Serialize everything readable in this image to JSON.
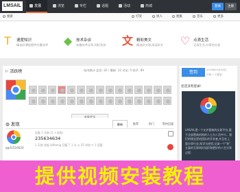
{
  "topnav": {
    "logo": "LMSAIL",
    "items": [
      {
        "label": "发展"
      },
      {
        "label": "浏览"
      },
      {
        "label": "专栏"
      },
      {
        "label": "话题"
      },
      {
        "label": "活动"
      },
      {
        "label": "商城"
      }
    ],
    "login_label": "登录",
    "register_label": "注册"
  },
  "subnav": {
    "search_label": "搜索",
    "items": [
      {
        "label": "打赏"
      },
      {
        "label": "找人"
      },
      {
        "label": "图集"
      },
      {
        "label": "音乐"
      },
      {
        "label": "更多"
      }
    ]
  },
  "cards": [
    {
      "title": "速度知识",
      "desc": "精选好课程提供大量技术",
      "icon": "T",
      "color": "#f0b429"
    },
    {
      "title": "技术杂谈",
      "desc": "有趣技术分享,同好交流",
      "icon": "◆",
      "color": "#6cc24a"
    },
    {
      "title": "精彩美文",
      "desc": "精选好文章,阅读好文",
      "icon": "文",
      "color": "#e8563c"
    },
    {
      "title": "点滴生活",
      "desc": "记录生活,分享的点滴",
      "icon": "♡",
      "color": "#e64f8c"
    }
  ],
  "activity": {
    "title": "活跃榜",
    "stats": "站内统计   会员: 83 / 最新: 22   讨论: 5   帖子: 89",
    "more": "查看更多"
  },
  "discover": {
    "title": "发现",
    "tabs": [
      {
        "label": "最新"
      },
      {
        "label": "推荐"
      },
      {
        "label": "热门"
      },
      {
        "label": "等待回复"
      }
    ],
    "post": {
      "user": "qq41516620",
      "meta": "回复 1 天前 (2 人浏览)",
      "title": "235634634",
      "stats": "1 天前   发起   billbeng 回复了 1 分   ◎ 35 浏览   ✎ 1 回复"
    }
  },
  "sidebar": {
    "signin_label": "签到",
    "signin_date": "2020年01月18日",
    "signin_count": "已有 1 人签到",
    "login_prompt": "您还没有登录!",
    "description": "LMSAIL是一个允许营商的交易平台,基于全部营商机构的人士为人员中介。我们的理念是给团队的开发者,并且在上面分享行业,知识与经验,记录一个\"秋\" 立展的互联网好组织和更好的人生分享过程."
  },
  "banner": {
    "text": "提供视频安装教程"
  }
}
